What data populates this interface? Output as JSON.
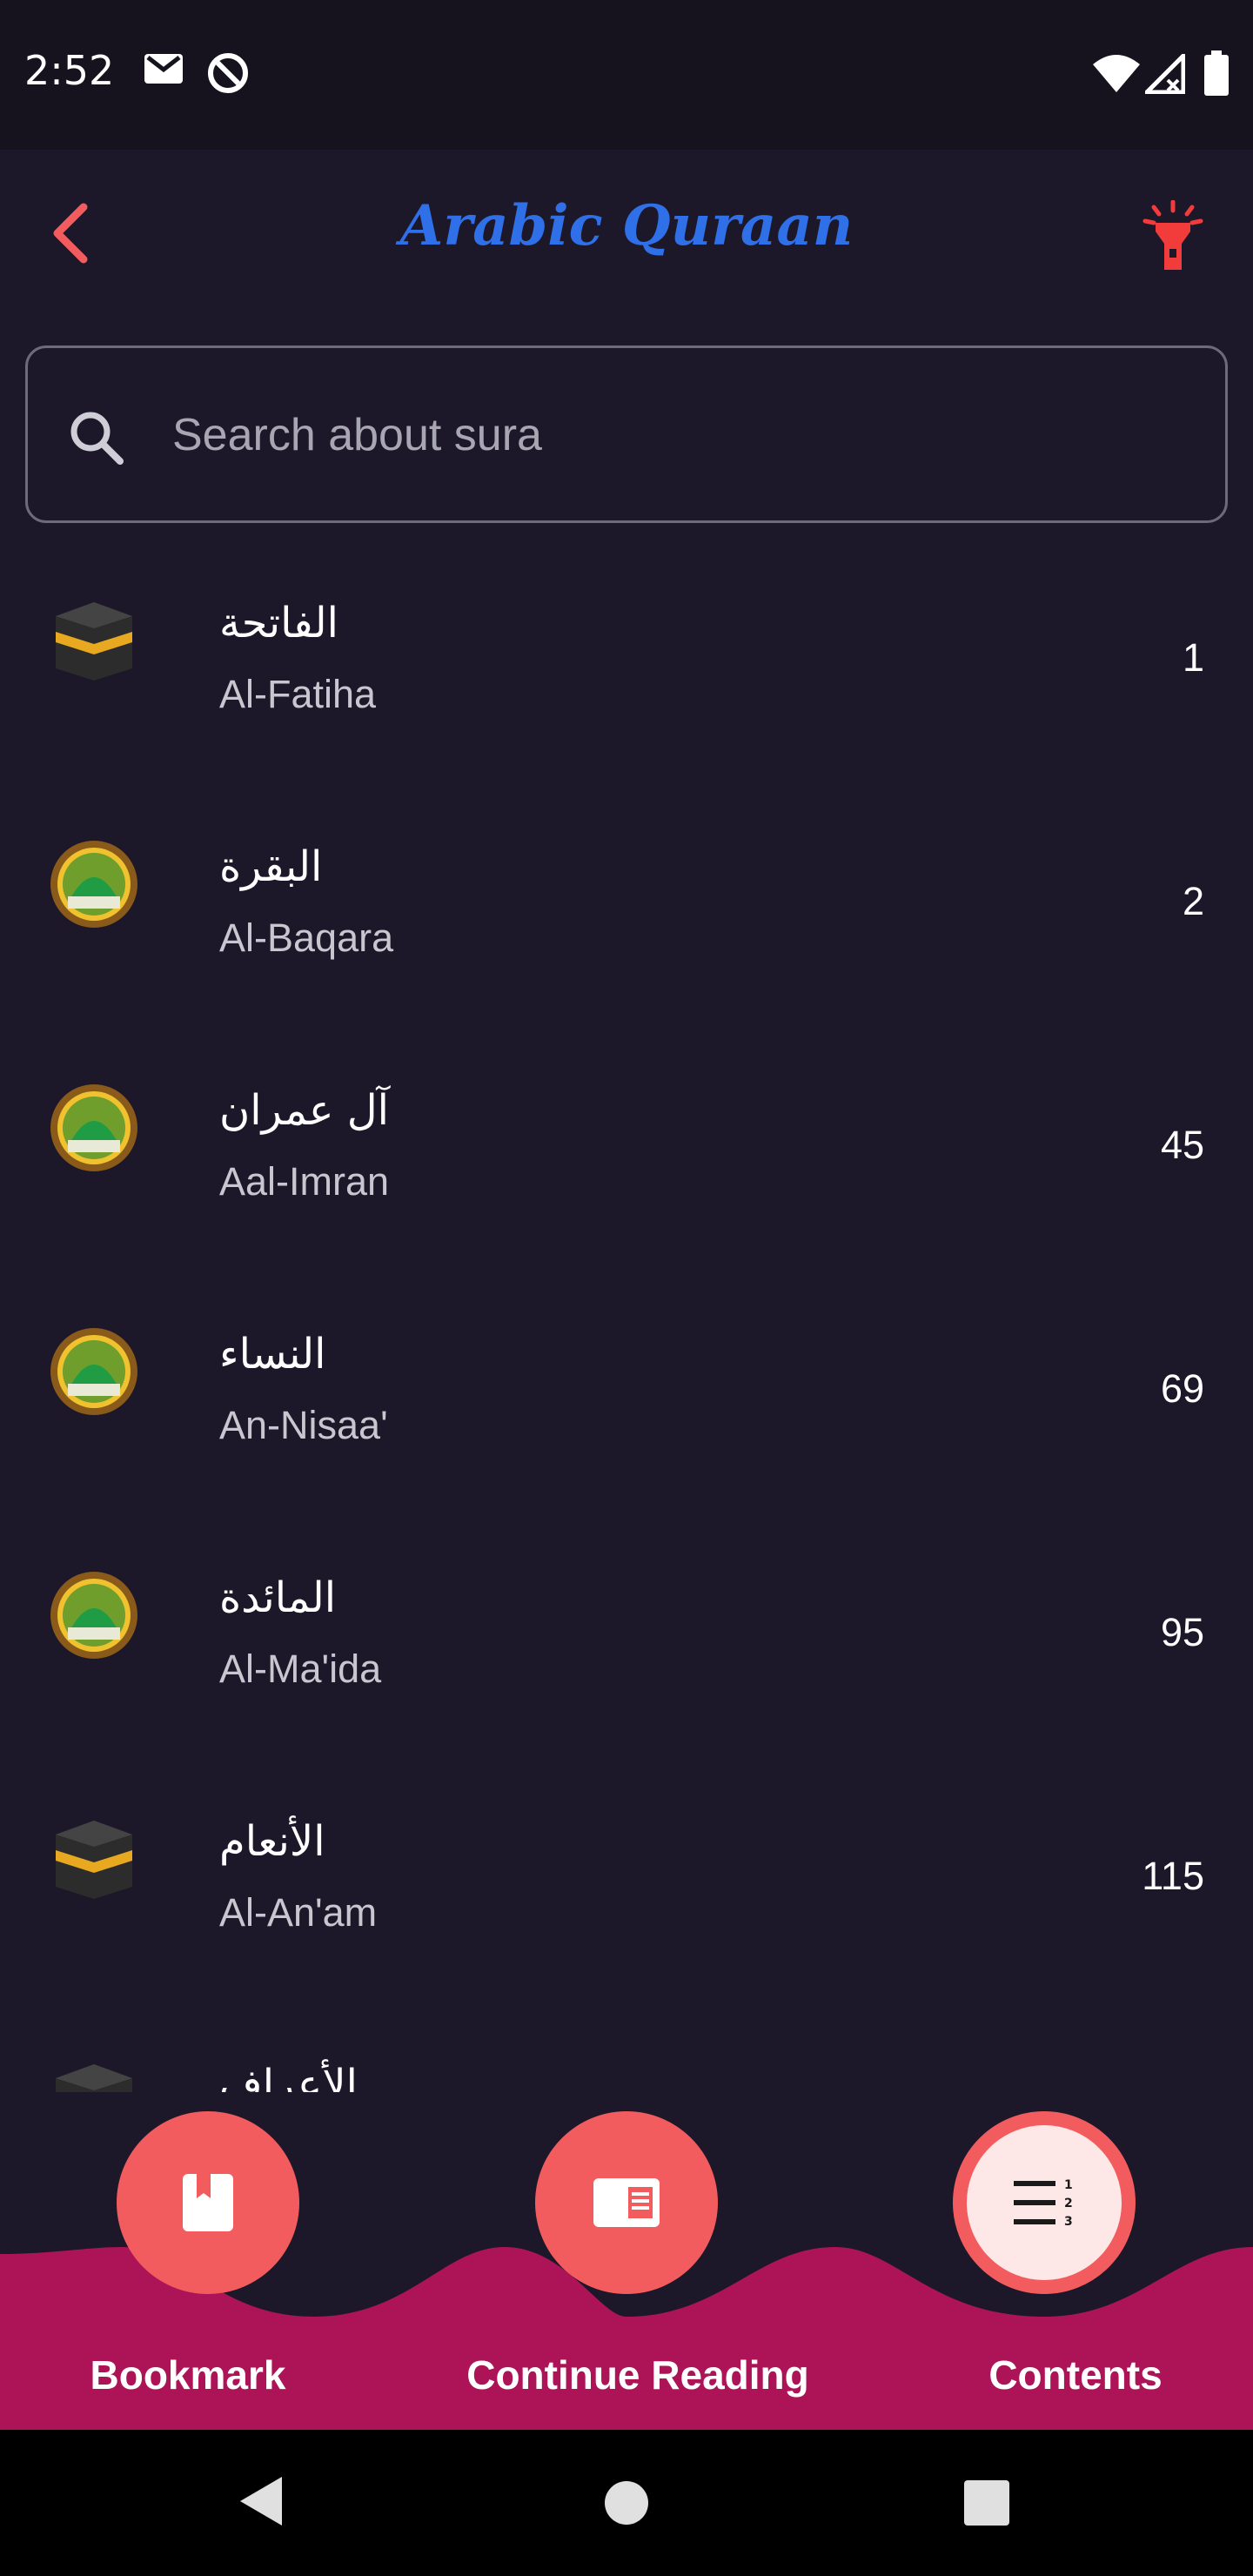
{
  "status_bar": {
    "time": "2:52",
    "icons": [
      "gmail-icon",
      "sync-off-icon",
      "wifi-icon",
      "signal-icon",
      "battery-icon"
    ]
  },
  "app_bar": {
    "title": "Arabic Quraan",
    "back_icon": "back-arrow-icon",
    "action_icon": "torch-icon"
  },
  "search": {
    "placeholder": "Search about sura",
    "value": ""
  },
  "suras": [
    {
      "arabic": "الفاتحة",
      "latin": "Al-Fatiha",
      "number": "1",
      "icon": "kaaba"
    },
    {
      "arabic": "البقرة",
      "latin": "Al-Baqara",
      "number": "2",
      "icon": "mosque"
    },
    {
      "arabic": "آل عمران",
      "latin": "Aal-Imran",
      "number": "45",
      "icon": "mosque"
    },
    {
      "arabic": "النساء",
      "latin": "An-Nisaa'",
      "number": "69",
      "icon": "mosque"
    },
    {
      "arabic": "المائدة",
      "latin": "Al-Ma'ida",
      "number": "95",
      "icon": "mosque"
    },
    {
      "arabic": "الأنعام",
      "latin": "Al-An'am",
      "number": "115",
      "icon": "kaaba"
    },
    {
      "arabic": "الأعراف",
      "latin": "",
      "number": "",
      "icon": "kaaba"
    }
  ],
  "bottom_nav": {
    "bookmark_label": "Bookmark",
    "continue_label": "Continue Reading",
    "contents_label": "Contents",
    "active": "contents"
  },
  "colors": {
    "background": "#1c1829",
    "accent": "#f25c5f",
    "nav_bar": "#ad1457",
    "title": "#2f6fe8"
  }
}
